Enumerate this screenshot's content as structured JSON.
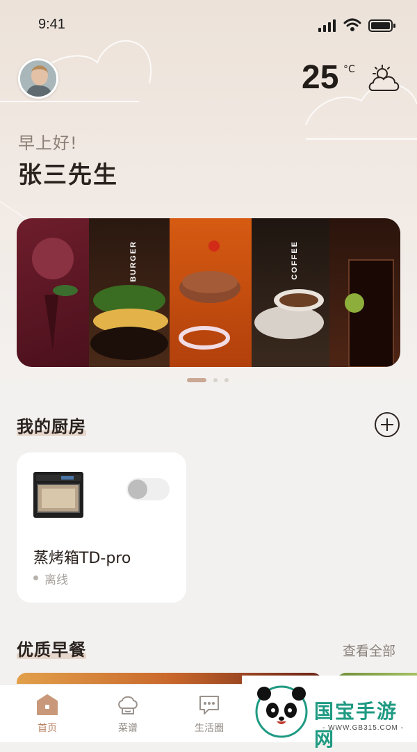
{
  "status_bar": {
    "time": "9:41",
    "icons": [
      "signal-icon",
      "wifi-icon",
      "battery-icon"
    ]
  },
  "header": {
    "temperature": "25",
    "temperature_unit": "°C",
    "weather_icon": "partly-cloudy-icon",
    "greeting": "早上好!",
    "user_name": "张三先生"
  },
  "banner": {
    "panels": [
      {
        "label": "",
        "theme": "ice-cream"
      },
      {
        "label": "BURGER",
        "theme": "burger"
      },
      {
        "label": "",
        "theme": "steak"
      },
      {
        "label": "COFFEE",
        "theme": "coffee"
      },
      {
        "label": "",
        "theme": "cola"
      }
    ],
    "active_page": 1,
    "page_count": 3
  },
  "my_kitchen": {
    "title": "我的厨房",
    "add_icon": "plus-circle-icon",
    "devices": [
      {
        "name": "蒸烤箱TD-pro",
        "status": "离线",
        "power_on": false
      }
    ]
  },
  "breakfast": {
    "title": "优质早餐",
    "view_all_label": "查看全部"
  },
  "tabbar": {
    "tabs": [
      {
        "label": "首页",
        "icon": "home-icon",
        "active": true
      },
      {
        "label": "菜谱",
        "icon": "chef-hat-icon",
        "active": false
      },
      {
        "label": "生活圈",
        "icon": "chat-bubble-icon",
        "active": false
      }
    ]
  },
  "watermark": {
    "title": "国宝手游网",
    "url": "- WWW.GB315.COM -"
  },
  "colors": {
    "accent": "#b98465",
    "background": "#f3f1ef",
    "card": "#ffffff"
  }
}
